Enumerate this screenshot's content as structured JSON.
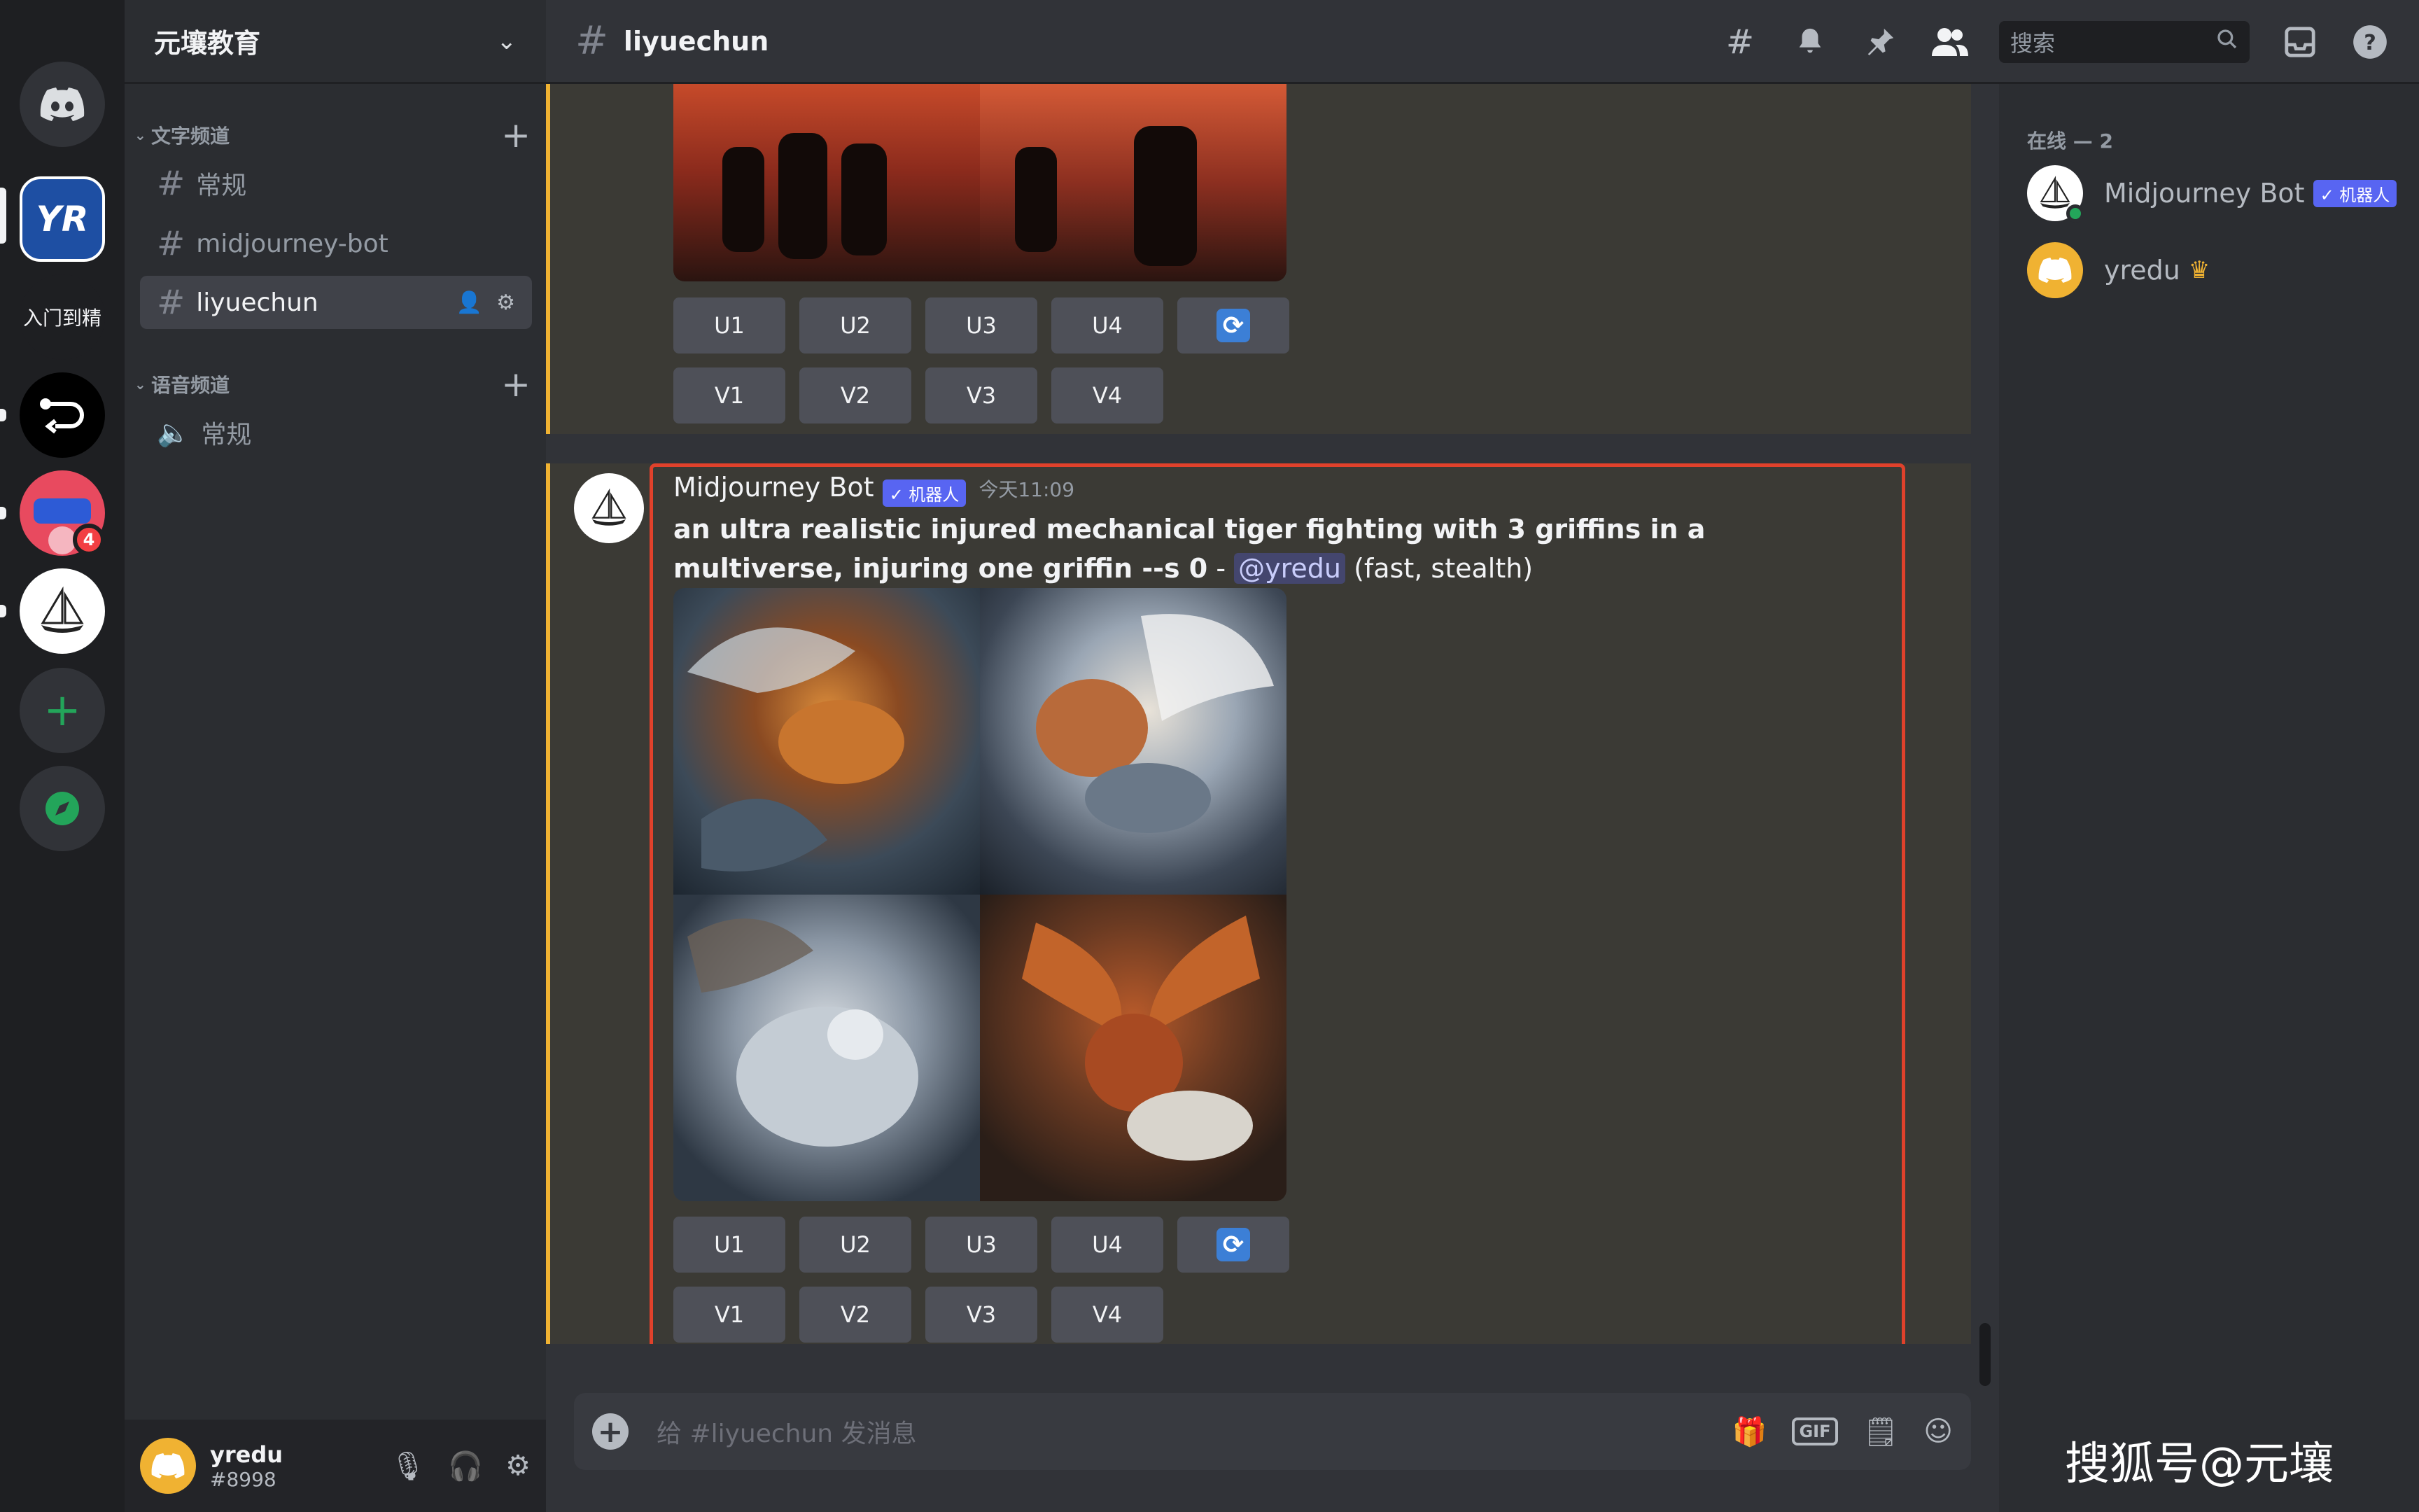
{
  "server": {
    "name": "元壤教育",
    "rail_label": "入门到精",
    "mention_badge": "4"
  },
  "categories": {
    "text": "文字频道",
    "voice": "语音频道"
  },
  "channels": {
    "text": [
      {
        "name": "常规"
      },
      {
        "name": "midjourney-bot"
      },
      {
        "name": "liyuechun"
      }
    ],
    "voice": [
      {
        "name": "常规"
      }
    ]
  },
  "header": {
    "channel": "liyuechun",
    "search_placeholder": "搜索"
  },
  "message_prev": {
    "buttons_upscale": [
      "U1",
      "U2",
      "U3",
      "U4"
    ],
    "buttons_variation": [
      "V1",
      "V2",
      "V3",
      "V4"
    ]
  },
  "message": {
    "author": "Midjourney Bot",
    "bot_tag": "✓ 机器人",
    "timestamp": "今天11:09",
    "prompt_bold": "an ultra realistic injured mechanical tiger fighting with 3 griffins in a multiverse, injuring one griffin --s 0",
    "prompt_dash": " - ",
    "mention": "@yredu",
    "suffix": " (fast, stealth)",
    "buttons_upscale": [
      "U1",
      "U2",
      "U3",
      "U4"
    ],
    "buttons_variation": [
      "V1",
      "V2",
      "V3",
      "V4"
    ]
  },
  "input": {
    "placeholder": "给 #liyuechun 发消息"
  },
  "members": {
    "heading": "在线 — 2",
    "list": [
      {
        "name": "Midjourney Bot",
        "tag": "✓ 机器人"
      },
      {
        "name": "yredu"
      }
    ]
  },
  "user": {
    "name": "yredu",
    "discriminator": "#8998"
  },
  "watermark": "搜狐号@元壤",
  "colors": {
    "accent": "#5865f2",
    "highlight_border": "#e0412b",
    "message_bar": "#f0b232",
    "online": "#23a55a"
  }
}
